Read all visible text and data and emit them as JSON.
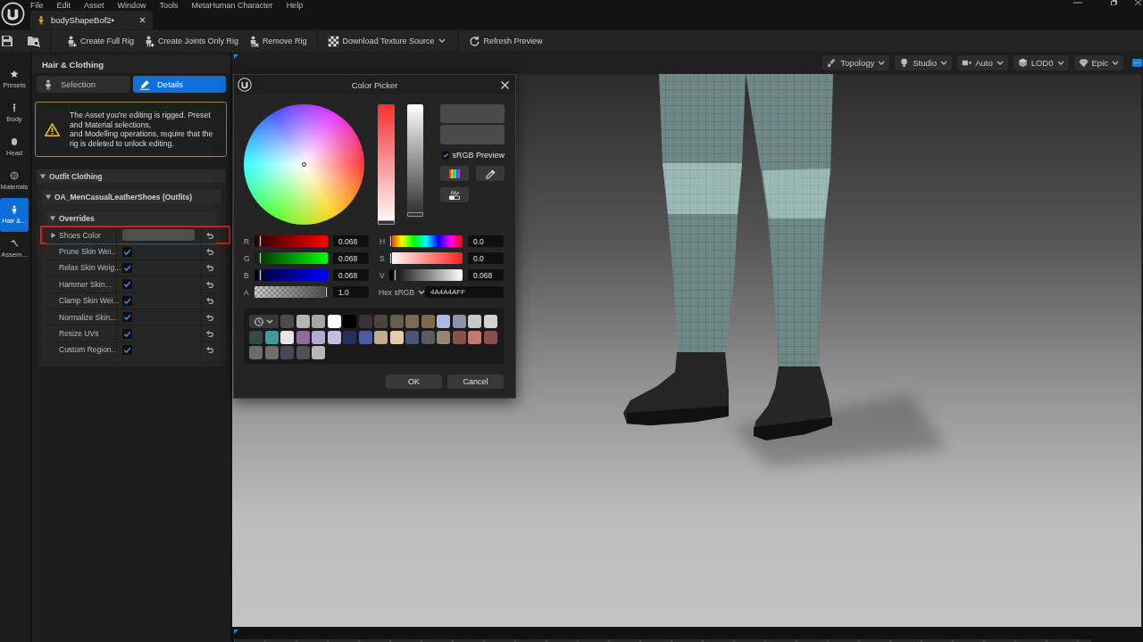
{
  "menu_bar": [
    "File",
    "Edit",
    "Asset",
    "Window",
    "Tools",
    "MetaHuman Character",
    "Help"
  ],
  "document_tab": {
    "title": "bodyShapeBof2•"
  },
  "toolbar": [
    {
      "kind": "button",
      "label": "Create Full Rig"
    },
    {
      "kind": "button",
      "label": "Create Joints Only Rig"
    },
    {
      "kind": "button",
      "label": "Remove Rig"
    },
    {
      "kind": "dropdown",
      "label": "Download Texture Source"
    },
    {
      "kind": "button",
      "label": "Refresh Preview"
    }
  ],
  "side_nav": [
    {
      "label": "Presets",
      "selected": false
    },
    {
      "label": "Body",
      "selected": false
    },
    {
      "label": "Head",
      "selected": false
    },
    {
      "label": "Materials",
      "selected": false
    },
    {
      "label": "Hair &...",
      "selected": true
    },
    {
      "label": "Assem...",
      "selected": false
    }
  ],
  "panel": {
    "title": "Hair & Clothing",
    "tabs": [
      {
        "label": "Selection",
        "selected": false
      },
      {
        "label": "Details",
        "selected": true
      }
    ],
    "warning": "The Asset you're editing is rigged. Preset and Material selections,\nand Modelling operations, require that the rig is deleted to unlock editing.",
    "sections": [
      {
        "label": "Outfit Clothing",
        "expanded": true,
        "children": [
          {
            "label": "OA_MenCasualLeatherShoes (Outfits)",
            "expanded": true,
            "children": [
              {
                "label": "Overrides",
                "expanded": true,
                "properties": [
                  {
                    "kind": "color",
                    "label": "Shoes Color",
                    "expanded": false,
                    "color": "#4f4f4f",
                    "highlighted": true
                  },
                  {
                    "kind": "checkbox",
                    "label": "Prune Skin Wei...",
                    "checked": true
                  },
                  {
                    "kind": "checkbox",
                    "label": "Relax Skin Weig...",
                    "checked": true
                  },
                  {
                    "kind": "checkbox",
                    "label": "Hammer Skin...",
                    "checked": true
                  },
                  {
                    "kind": "checkbox",
                    "label": "Clamp Skin Wei...",
                    "checked": true
                  },
                  {
                    "kind": "checkbox",
                    "label": "Normalize Skin...",
                    "checked": true
                  },
                  {
                    "kind": "checkbox",
                    "label": "Resize UVs",
                    "checked": true
                  },
                  {
                    "kind": "checkbox",
                    "label": "Custom Region...",
                    "checked": true
                  }
                ]
              }
            ]
          }
        ]
      }
    ]
  },
  "viewport_toolbar": [
    {
      "label": "Topology"
    },
    {
      "label": "Studio"
    },
    {
      "label": "Auto"
    },
    {
      "label": "LOD0"
    },
    {
      "label": "Epic"
    }
  ],
  "color_picker": {
    "title": "Color Picker",
    "previews": [
      {
        "color": "#4a4a4a"
      },
      {
        "color": "#4a4a4a"
      }
    ],
    "bars": [
      {
        "kind": "saturation",
        "level": 0
      },
      {
        "kind": "value",
        "level": 0.068
      }
    ],
    "srgb_preview": {
      "label": "sRGB Preview",
      "checked": true
    },
    "channels": [
      {
        "label": "R",
        "kind": "red",
        "level": 0.068,
        "value": "0.068"
      },
      {
        "label": "G",
        "kind": "green",
        "level": 0.068,
        "value": "0.068"
      },
      {
        "label": "B",
        "kind": "blue",
        "level": 0.068,
        "value": "0.068"
      },
      {
        "label": "A",
        "kind": "alpha",
        "level": 1,
        "value": "1.0"
      }
    ],
    "hsv": [
      {
        "label": "H",
        "kind": "hue",
        "level": 0,
        "value": "0.0"
      },
      {
        "label": "S",
        "kind": "saturation",
        "level": 0,
        "value": "0.0"
      },
      {
        "label": "V",
        "kind": "value",
        "level": 0.068,
        "value": "0.068"
      }
    ],
    "hex": {
      "label": "Hex sRGB",
      "value": "4A4A4AFF"
    },
    "swatches": [
      {
        "color": "#4b4b4b"
      },
      {
        "color": "#b4b4b4"
      },
      {
        "color": "#a6a6a6"
      },
      {
        "color": "#ffffff"
      },
      {
        "color": "#000000"
      },
      {
        "color": "#363239"
      },
      {
        "color": "#4d4437"
      },
      {
        "color": "#695c49"
      },
      {
        "color": "#7a6c53"
      },
      {
        "color": "#7b6a47"
      },
      {
        "color": "#a9bde3"
      },
      {
        "color": "#8a93ab"
      },
      {
        "color": "#c9c9c9"
      },
      {
        "color": "#d2d2d2"
      },
      {
        "color": "#354a40"
      },
      {
        "color": "#3f9b9c"
      },
      {
        "color": "#e6e6e6"
      },
      {
        "color": "#8e6b9b"
      },
      {
        "color": "#b3a9d3"
      },
      {
        "color": "#c4bde3"
      },
      {
        "color": "#27305a"
      },
      {
        "color": "#4b5ca5"
      },
      {
        "color": "#c4aa8e"
      },
      {
        "color": "#e9cba8"
      },
      {
        "color": "#4a5672"
      },
      {
        "color": "#5a5b5d"
      },
      {
        "color": "#958670"
      },
      {
        "color": "#8b5149"
      },
      {
        "color": "#c37b6e"
      },
      {
        "color": "#86514b"
      },
      {
        "color": "#6b6b6b"
      },
      {
        "color": "#6e6e6e"
      },
      {
        "color": "#4b4555"
      },
      {
        "color": "#515151"
      },
      {
        "color": "#b7b7b7"
      }
    ],
    "buttons": [
      {
        "label": "OK"
      },
      {
        "label": "Cancel"
      }
    ]
  }
}
